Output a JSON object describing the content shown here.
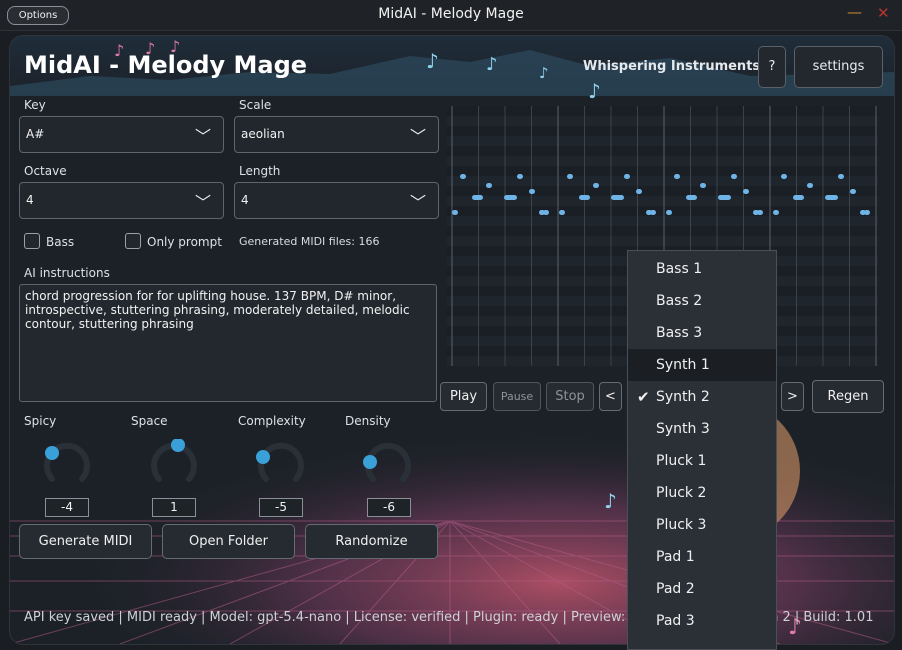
{
  "window": {
    "options_label": "Options",
    "title": "MidAI - Melody Mage",
    "minimize_icon": "minimize-icon",
    "close_icon": "close-icon"
  },
  "header": {
    "app_title": "MidAI - Melody Mage",
    "subtitle": "Whispering Instruments",
    "help_label": "?",
    "settings_label": "settings"
  },
  "fields": {
    "key": {
      "label": "Key",
      "value": "A#"
    },
    "scale": {
      "label": "Scale",
      "value": "aeolian"
    },
    "octave": {
      "label": "Octave",
      "value": "4"
    },
    "length": {
      "label": "Length",
      "value": "4"
    }
  },
  "options": {
    "bass_label": "Bass",
    "bass_checked": false,
    "only_prompt_label": "Only prompt",
    "only_prompt_checked": false,
    "generated_files": "Generated MIDI files: 166"
  },
  "ai": {
    "label": "AI instructions",
    "text": "chord progression for for uplifting house. 137 BPM, D# minor, introspective, stuttering phrasing, moderately detailed, melodic contour, stuttering phrasing"
  },
  "knobs": [
    {
      "label": "Spicy",
      "value": "-4"
    },
    {
      "label": "Space",
      "value": "1"
    },
    {
      "label": "Complexity",
      "value": "-5"
    },
    {
      "label": "Density",
      "value": "-6"
    }
  ],
  "actions": {
    "generate": "Generate MIDI",
    "open_folder": "Open Folder",
    "randomize": "Randomize"
  },
  "transport": {
    "play": "Play",
    "pause": "Pause",
    "stop": "Stop",
    "prev": "<",
    "next": ">",
    "regen": "Regen"
  },
  "instrument_menu": {
    "items": [
      "Bass 1",
      "Bass 2",
      "Bass 3",
      "Synth 1",
      "Synth 2",
      "Synth 3",
      "Pluck 1",
      "Pluck 2",
      "Pluck 3",
      "Pad 1",
      "Pad 2",
      "Pad 3"
    ],
    "selected": "Synth 2",
    "highlighted": "Synth 1",
    "check_icon": "checkmark-icon"
  },
  "status": {
    "left": "API key saved | MIDI ready | Model: gpt-5.4-nano | License: verified | Plugin: ready | Preview: Pre",
    "right": "th 2 | Build: 1.01"
  },
  "colors": {
    "accent": "#3aa0d8",
    "note": "#6fb4e6",
    "background": "#1c2128"
  }
}
